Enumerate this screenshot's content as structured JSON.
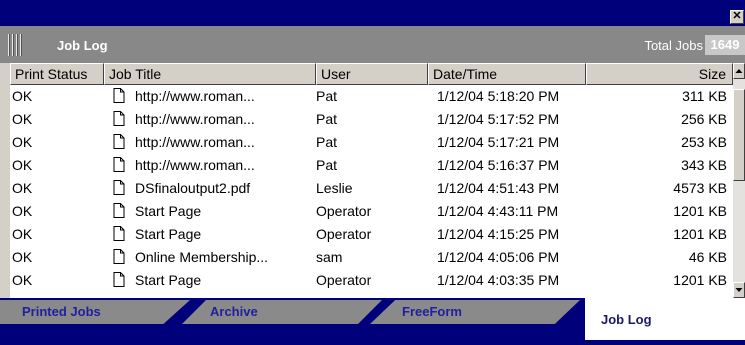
{
  "window": {
    "close_glyph": "✕"
  },
  "header": {
    "title": "Job Log",
    "total_label": "Total Jobs",
    "total_value": "1649",
    "grip_icon": "drag-grip-icon"
  },
  "columns": [
    "Print Status",
    "Job Title",
    "User",
    "Date/Time",
    "Size"
  ],
  "rows": [
    {
      "status": "OK",
      "title": "http://www.roman...",
      "user": "Pat",
      "datetime": "1/12/04 5:18:20 PM",
      "size": "311 KB"
    },
    {
      "status": "OK",
      "title": "http://www.roman...",
      "user": "Pat",
      "datetime": "1/12/04 5:17:52 PM",
      "size": "256 KB"
    },
    {
      "status": "OK",
      "title": "http://www.roman...",
      "user": "Pat",
      "datetime": "1/12/04 5:17:21 PM",
      "size": "253 KB"
    },
    {
      "status": "OK",
      "title": "http://www.roman...",
      "user": "Pat",
      "datetime": "1/12/04 5:16:37 PM",
      "size": "343 KB"
    },
    {
      "status": "OK",
      "title": "DSfinaloutput2.pdf",
      "user": "Leslie",
      "datetime": "1/12/04 4:51:43 PM",
      "size": "4573 KB"
    },
    {
      "status": "OK",
      "title": "Start Page",
      "user": "Operator",
      "datetime": "1/12/04 4:43:11 PM",
      "size": "1201 KB"
    },
    {
      "status": "OK",
      "title": "Start Page",
      "user": "Operator",
      "datetime": "1/12/04 4:15:25 PM",
      "size": "1201 KB"
    },
    {
      "status": "OK",
      "title": "Online Membership...",
      "user": "sam",
      "datetime": "1/12/04 4:05:06 PM",
      "size": "46 KB"
    },
    {
      "status": "OK",
      "title": "Start Page",
      "user": "Operator",
      "datetime": "1/12/04 4:03:35 PM",
      "size": "1201 KB"
    }
  ],
  "row_icon": "document-icon",
  "tabs": [
    {
      "label": "Printed Jobs",
      "active": false
    },
    {
      "label": "Archive",
      "active": false
    },
    {
      "label": "FreeForm",
      "active": false
    },
    {
      "label": "Job Log",
      "active": true
    }
  ],
  "colors": {
    "title_bar": "#00007a",
    "header_bar": "#888888",
    "tab_text": "#2020a0",
    "active_tab": "#ffffff"
  }
}
